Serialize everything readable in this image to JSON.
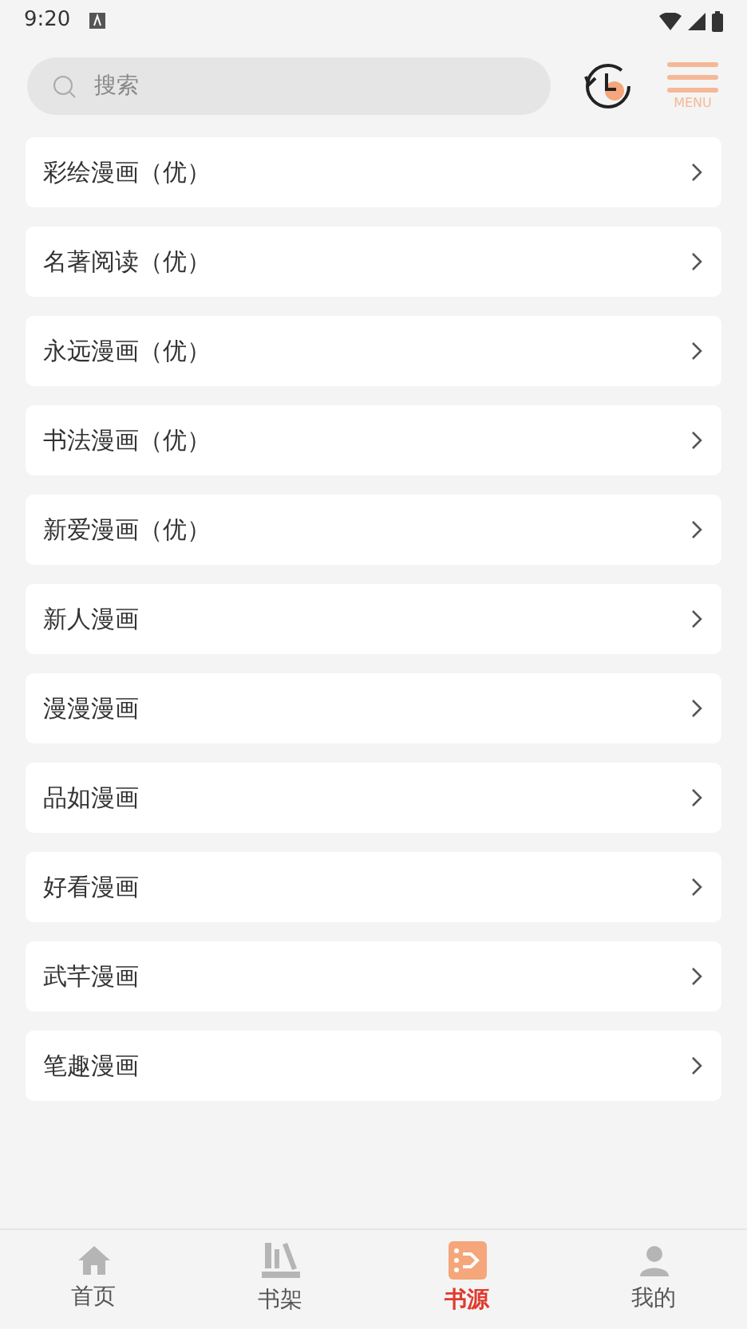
{
  "status_bar": {
    "time": "9:20"
  },
  "search": {
    "placeholder": "搜索"
  },
  "menu": {
    "label": "MENU"
  },
  "sources": [
    {
      "name": "彩绘漫画（优）"
    },
    {
      "name": "名著阅读（优）"
    },
    {
      "name": "永远漫画（优）"
    },
    {
      "name": "书法漫画（优）"
    },
    {
      "name": "新爱漫画（优）"
    },
    {
      "name": "新人漫画"
    },
    {
      "name": "漫漫漫画"
    },
    {
      "name": "品如漫画"
    },
    {
      "name": "好看漫画"
    },
    {
      "name": "武芊漫画"
    },
    {
      "name": "笔趣漫画"
    }
  ],
  "tabs": [
    {
      "label": "首页",
      "kind": "home",
      "selected": false
    },
    {
      "label": "书架",
      "kind": "shelf",
      "selected": false
    },
    {
      "label": "书源",
      "kind": "source",
      "selected": true
    },
    {
      "label": "我的",
      "kind": "me",
      "selected": false
    }
  ]
}
